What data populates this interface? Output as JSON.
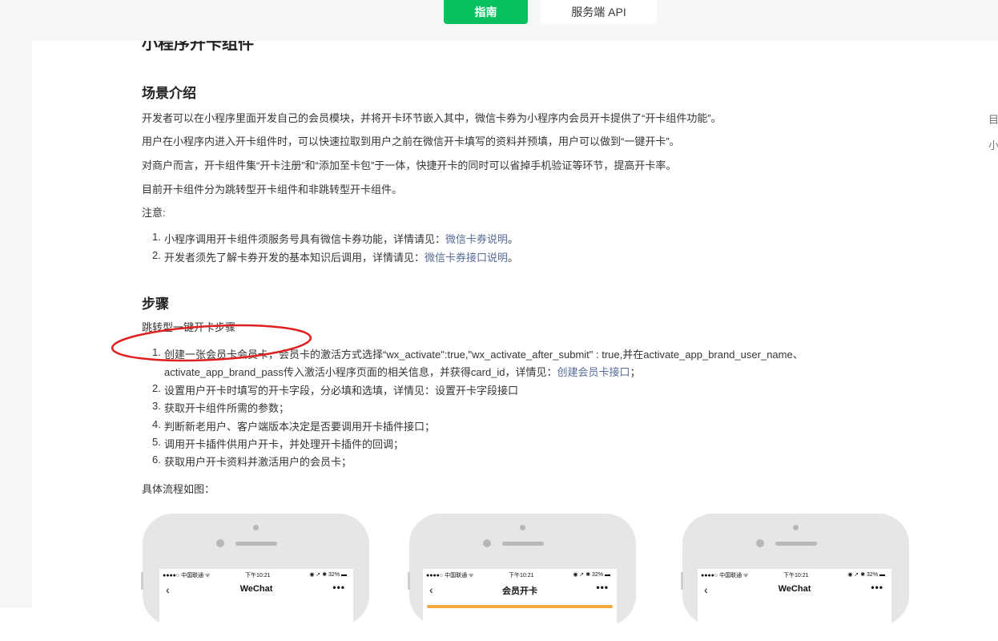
{
  "nav": {
    "guide_label": "指南",
    "api_label": "服务端 API"
  },
  "page_title": "小程序开卡组件",
  "scene": {
    "heading": "场景介绍",
    "paragraphs": [
      "开发者可以在小程序里面开发自己的会员模块，并将开卡环节嵌入其中，微信卡券为小程序内会员开卡提供了“开卡组件功能”。",
      "用户在小程序内进入开卡组件时，可以快速拉取到用户之前在微信开卡填写的资料并预填，用户可以做到“一键开卡”。",
      "对商户而言，开卡组件集“开卡注册”和“添加至卡包”于一体，快捷开卡的同时可以省掉手机验证等环节，提高开卡率。",
      "目前开卡组件分为跳转型开卡组件和非跳转型开卡组件。",
      "注意:"
    ],
    "notes": [
      {
        "num": "1.",
        "text": "小程序调用开卡组件须服务号具有微信卡券功能，详情请见：",
        "link": "微信卡券说明",
        "tail": "。"
      },
      {
        "num": "2.",
        "text": "开发者须先了解卡券开发的基本知识后调用，详情请见：",
        "link": "微信卡券接口说明",
        "tail": "。"
      }
    ]
  },
  "steps": {
    "heading": "步骤",
    "intro": "跳转型一键开卡步骤",
    "items": [
      {
        "num": "1.",
        "line1": "创建一张会员卡会员卡，会员卡的激活方式选择“wx_activate\":true,\"wx_activate_after_submit\" : true,并在activate_app_brand_user_name、",
        "line2": "activate_app_brand_pass传入激活小程序页面的相关信息，并获得card_id，详情见：",
        "link": "创建会员卡接口",
        "tail": "；"
      },
      {
        "num": "2.",
        "text": "设置用户开卡时填写的开卡字段，分必填和选填，详情见：设置开卡字段接口"
      },
      {
        "num": "3.",
        "text": "获取开卡组件所需的参数；"
      },
      {
        "num": "4.",
        "text": "判断新老用户、客户端版本决定是否要调用开卡插件接口；"
      },
      {
        "num": "5.",
        "text": "调用开卡插件供用户开卡，并处理开卡插件的回调；"
      },
      {
        "num": "6.",
        "text": "获取用户开卡资料并激活用户的会员卡；"
      }
    ],
    "flow_label": "具体流程如图："
  },
  "side_fragments": [
    "目",
    "小"
  ],
  "phones": [
    {
      "carrier": "●●●●○ 中国联通 ᯤ",
      "time": "下午10:21",
      "battery": "◉ ➚ ✱ 32% ▬",
      "title": "WeChat",
      "back": "‹",
      "more": "•••"
    },
    {
      "carrier": "●●●●○ 中国联通 ᯤ",
      "time": "下午10:21",
      "battery": "◉ ➚ ✱ 32% ▬",
      "title": "会员开卡",
      "back": "‹",
      "more": "•••"
    },
    {
      "carrier": "●●●●○ 中国联通 ᯤ",
      "time": "下午10:21",
      "battery": "◉ ➚ ✱ 32% ▬",
      "title": "WeChat",
      "back": "‹",
      "more": "•••"
    }
  ],
  "colors": {
    "accent": "#07c160",
    "link": "#576b95",
    "annotation": "#e02020",
    "phone_body": "#e6e6e6"
  }
}
